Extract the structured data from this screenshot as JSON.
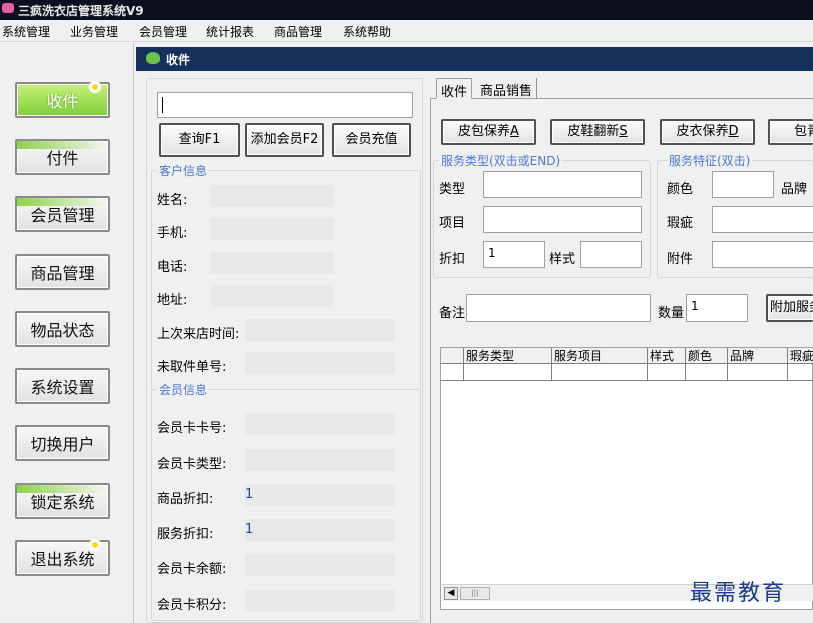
{
  "window": {
    "title": "三疯洗衣店管理系统V9"
  },
  "menu": [
    "系统管理",
    "业务管理",
    "会员管理",
    "统计报表",
    "商品管理",
    "系统帮助"
  ],
  "sidebar": {
    "items": [
      {
        "label": "收件"
      },
      {
        "label": "付件"
      },
      {
        "label": "会员管理"
      },
      {
        "label": "商品管理"
      },
      {
        "label": "物品状态"
      },
      {
        "label": "系统设置"
      },
      {
        "label": "切换用户"
      },
      {
        "label": "锁定系统"
      },
      {
        "label": "退出系统"
      }
    ]
  },
  "panel": {
    "title": "收件"
  },
  "search": {
    "value": ""
  },
  "actions": {
    "query": "查询F1",
    "add_member": "添加会员F2",
    "recharge": "会员充值"
  },
  "customer": {
    "title": "客户信息",
    "fields": [
      {
        "label": "姓名:",
        "value": ""
      },
      {
        "label": "手机:",
        "value": ""
      },
      {
        "label": "电话:",
        "value": ""
      },
      {
        "label": "地址:",
        "value": ""
      },
      {
        "label": "上次来店时间:",
        "value": ""
      },
      {
        "label": "未取件单号:",
        "value": ""
      }
    ]
  },
  "member": {
    "title": "会员信息",
    "fields": [
      {
        "label": "会员卡卡号:",
        "value": ""
      },
      {
        "label": "会员卡类型:",
        "value": ""
      },
      {
        "label": "商品折扣:",
        "value": "1"
      },
      {
        "label": "服务折扣:",
        "value": "1"
      },
      {
        "label": "会员卡余额:",
        "value": ""
      },
      {
        "label": "会员卡积分:",
        "value": ""
      }
    ]
  },
  "tabs": [
    "收件",
    "商品销售"
  ],
  "service_buttons": [
    {
      "text": "皮包保养",
      "key": "A"
    },
    {
      "text": "皮鞋翻新",
      "key": "S"
    },
    {
      "text": "皮衣保养",
      "key": "D"
    },
    {
      "text": "包青",
      "key": ""
    }
  ],
  "service_type": {
    "title": "服务类型(双击或END)",
    "type_label": "类型",
    "type_value": "",
    "item_label": "项目",
    "item_value": "",
    "discount_label": "折扣",
    "discount_value": "1",
    "style_label": "样式",
    "style_value": ""
  },
  "service_features": {
    "title": "服务特征(双击)",
    "color_label": "颜色",
    "brand_label": "品牌",
    "flaw_label": "瑕疵",
    "attachment_label": "附件"
  },
  "note": {
    "label": "备注",
    "value": "",
    "qty_label": "数量",
    "qty_value": "1",
    "extra_button": "附加服务"
  },
  "grid": {
    "columns": [
      "服务类型",
      "服务项目",
      "样式",
      "颜色",
      "品牌",
      "瑕疵"
    ]
  },
  "watermark": "最需教育"
}
